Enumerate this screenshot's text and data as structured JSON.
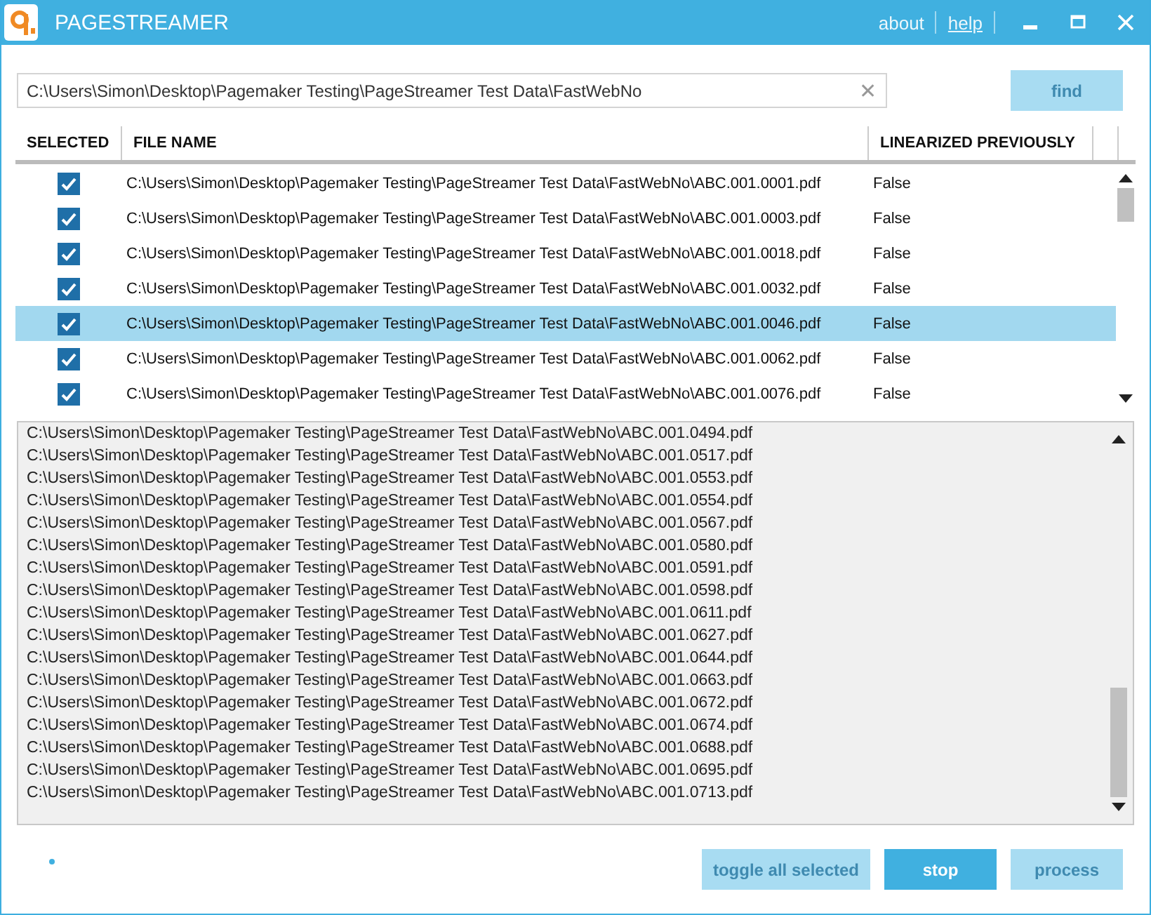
{
  "window": {
    "title": "PAGESTREAMER",
    "links": [
      {
        "label": "about",
        "underlined": false
      },
      {
        "label": "help",
        "underlined": true
      }
    ]
  },
  "search": {
    "value": "C:\\Users\\Simon\\Desktop\\Pagemaker Testing\\PageStreamer Test Data\\FastWebNo",
    "clear": "✕"
  },
  "find_button": {
    "label": "find",
    "disabled": true
  },
  "table": {
    "columns": [
      "SELECTED",
      "FILE NAME",
      "LINEARIZED PREVIOUSLY"
    ],
    "rows": [
      {
        "checked": true,
        "selected": false,
        "file": "C:\\Users\\Simon\\Desktop\\Pagemaker Testing\\PageStreamer Test Data\\FastWebNo\\ABC.001.0001.pdf",
        "linearized": "False"
      },
      {
        "checked": true,
        "selected": false,
        "file": "C:\\Users\\Simon\\Desktop\\Pagemaker Testing\\PageStreamer Test Data\\FastWebNo\\ABC.001.0003.pdf",
        "linearized": "False"
      },
      {
        "checked": true,
        "selected": false,
        "file": "C:\\Users\\Simon\\Desktop\\Pagemaker Testing\\PageStreamer Test Data\\FastWebNo\\ABC.001.0018.pdf",
        "linearized": "False"
      },
      {
        "checked": true,
        "selected": false,
        "file": "C:\\Users\\Simon\\Desktop\\Pagemaker Testing\\PageStreamer Test Data\\FastWebNo\\ABC.001.0032.pdf",
        "linearized": "False"
      },
      {
        "checked": true,
        "selected": true,
        "file": "C:\\Users\\Simon\\Desktop\\Pagemaker Testing\\PageStreamer Test Data\\FastWebNo\\ABC.001.0046.pdf",
        "linearized": "False"
      },
      {
        "checked": true,
        "selected": false,
        "file": "C:\\Users\\Simon\\Desktop\\Pagemaker Testing\\PageStreamer Test Data\\FastWebNo\\ABC.001.0062.pdf",
        "linearized": "False"
      },
      {
        "checked": true,
        "selected": false,
        "file": "C:\\Users\\Simon\\Desktop\\Pagemaker Testing\\PageStreamer Test Data\\FastWebNo\\ABC.001.0076.pdf",
        "linearized": "False"
      }
    ]
  },
  "log": [
    "C:\\Users\\Simon\\Desktop\\Pagemaker Testing\\PageStreamer Test Data\\FastWebNo\\ABC.001.0494.pdf",
    "C:\\Users\\Simon\\Desktop\\Pagemaker Testing\\PageStreamer Test Data\\FastWebNo\\ABC.001.0517.pdf",
    "C:\\Users\\Simon\\Desktop\\Pagemaker Testing\\PageStreamer Test Data\\FastWebNo\\ABC.001.0553.pdf",
    "C:\\Users\\Simon\\Desktop\\Pagemaker Testing\\PageStreamer Test Data\\FastWebNo\\ABC.001.0554.pdf",
    "C:\\Users\\Simon\\Desktop\\Pagemaker Testing\\PageStreamer Test Data\\FastWebNo\\ABC.001.0567.pdf",
    "C:\\Users\\Simon\\Desktop\\Pagemaker Testing\\PageStreamer Test Data\\FastWebNo\\ABC.001.0580.pdf",
    "C:\\Users\\Simon\\Desktop\\Pagemaker Testing\\PageStreamer Test Data\\FastWebNo\\ABC.001.0591.pdf",
    "C:\\Users\\Simon\\Desktop\\Pagemaker Testing\\PageStreamer Test Data\\FastWebNo\\ABC.001.0598.pdf",
    "C:\\Users\\Simon\\Desktop\\Pagemaker Testing\\PageStreamer Test Data\\FastWebNo\\ABC.001.0611.pdf",
    "C:\\Users\\Simon\\Desktop\\Pagemaker Testing\\PageStreamer Test Data\\FastWebNo\\ABC.001.0627.pdf",
    "C:\\Users\\Simon\\Desktop\\Pagemaker Testing\\PageStreamer Test Data\\FastWebNo\\ABC.001.0644.pdf",
    "C:\\Users\\Simon\\Desktop\\Pagemaker Testing\\PageStreamer Test Data\\FastWebNo\\ABC.001.0663.pdf",
    "C:\\Users\\Simon\\Desktop\\Pagemaker Testing\\PageStreamer Test Data\\FastWebNo\\ABC.001.0672.pdf",
    "C:\\Users\\Simon\\Desktop\\Pagemaker Testing\\PageStreamer Test Data\\FastWebNo\\ABC.001.0674.pdf",
    "C:\\Users\\Simon\\Desktop\\Pagemaker Testing\\PageStreamer Test Data\\FastWebNo\\ABC.001.0688.pdf",
    "C:\\Users\\Simon\\Desktop\\Pagemaker Testing\\PageStreamer Test Data\\FastWebNo\\ABC.001.0695.pdf",
    "C:\\Users\\Simon\\Desktop\\Pagemaker Testing\\PageStreamer Test Data\\FastWebNo\\ABC.001.0713.pdf"
  ],
  "buttons": [
    {
      "label": "toggle all selected",
      "disabled": true
    },
    {
      "label": "stop",
      "disabled": false
    },
    {
      "label": "process",
      "disabled": true
    }
  ]
}
